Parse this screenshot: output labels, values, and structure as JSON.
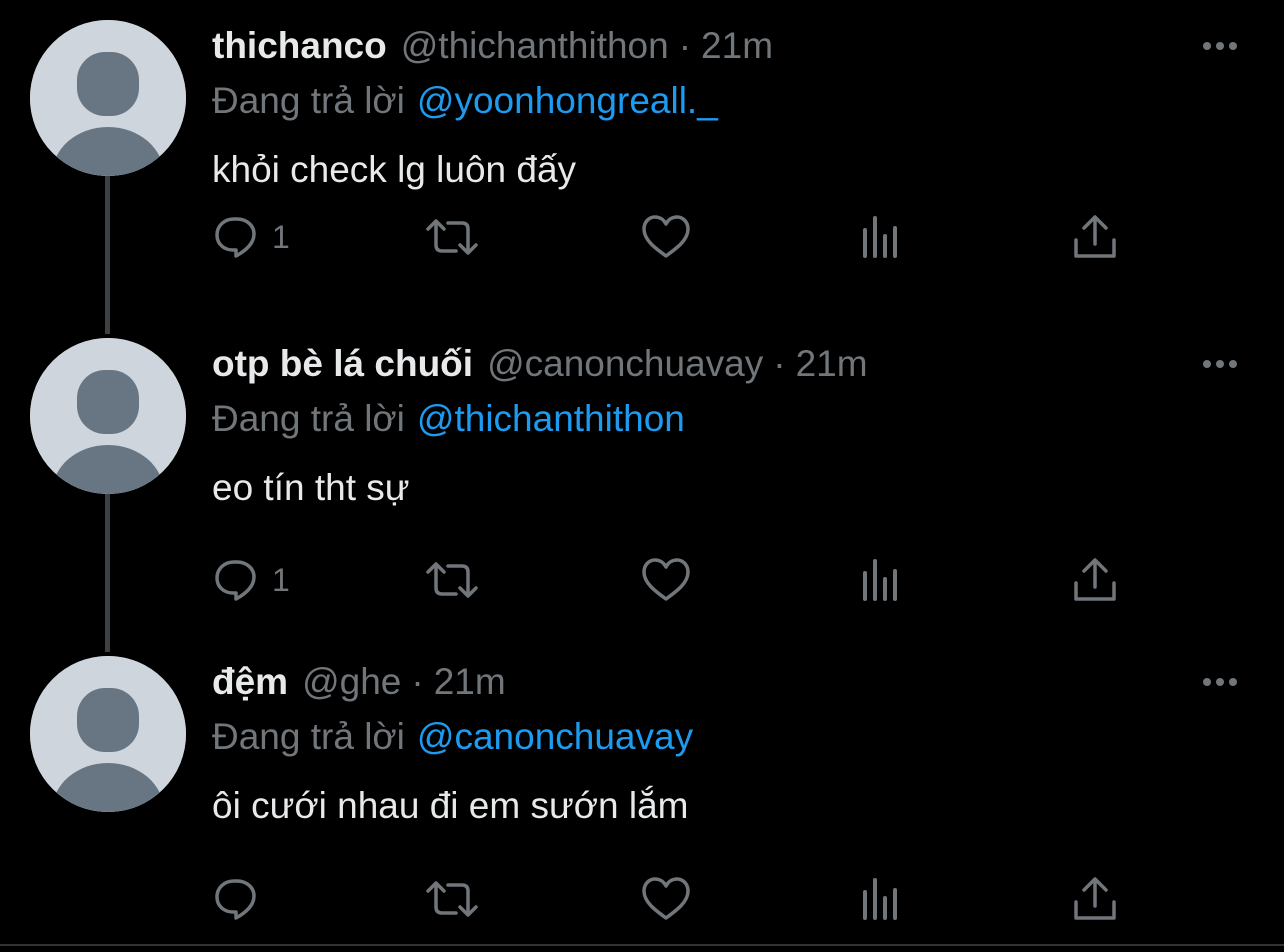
{
  "tweets": [
    {
      "display_name": "thichanco",
      "handle": "@thichanthithon",
      "separator": "·",
      "time": "21m",
      "reply_prefix": "Đang trả lời",
      "reply_to": "@yoonhongreall._",
      "text": "khỏi check lg luôn đấy",
      "reply_count": "1"
    },
    {
      "display_name": "otp bè lá chuối",
      "handle": "@canonchuavay",
      "separator": "·",
      "time": "21m",
      "reply_prefix": "Đang trả lời",
      "reply_to": "@thichanthithon",
      "text": "eo tín tht sự",
      "reply_count": "1"
    },
    {
      "display_name": "đệm",
      "handle": "@ghe",
      "separator": "·",
      "time": "21m",
      "reply_prefix": "Đang trả lời",
      "reply_to": "@canonchuavay",
      "text": "ôi cưới nhau đi em sướn lắm",
      "reply_count": ""
    }
  ],
  "icons": {
    "reply": "speech-bubble-icon",
    "retweet": "retweet-icon",
    "like": "heart-icon",
    "views": "bar-chart-icon",
    "share": "share-upload-icon",
    "more": "more-horizontal-icon"
  },
  "colors": {
    "background": "#000000",
    "text_primary": "#e7e9ea",
    "text_secondary": "#71767b",
    "mention": "#1d9bf0",
    "avatar_bg": "#ced5dc",
    "avatar_figure": "#687684",
    "thread_line": "#3e4144"
  }
}
